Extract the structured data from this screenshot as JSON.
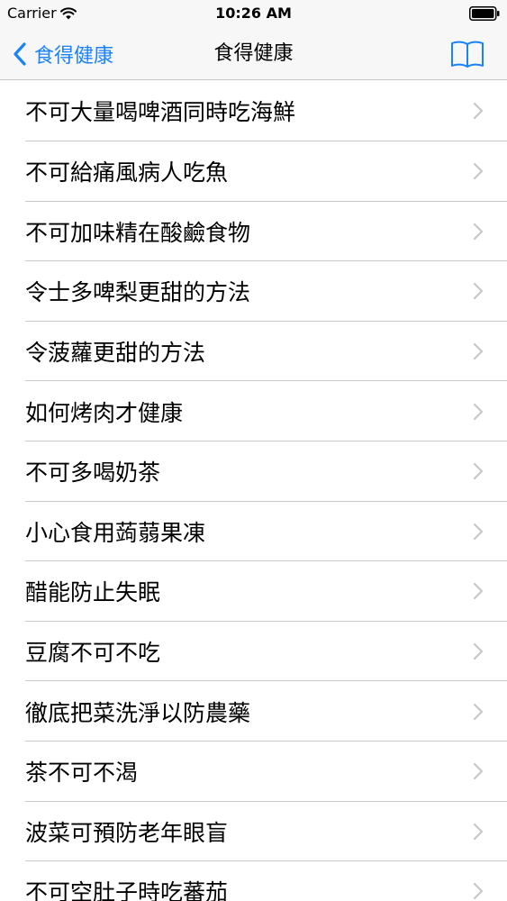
{
  "status_bar": {
    "carrier": "Carrier",
    "time": "10:26 AM",
    "wifi_icon": "wifi-icon",
    "battery_icon": "battery-icon"
  },
  "nav_bar": {
    "back_label": "食得健康",
    "title": "食得健康",
    "back_icon": "chevron-left-icon",
    "right_icon": "book-icon",
    "accent_color": "#1a82fb"
  },
  "list": {
    "items": [
      {
        "label": "不可大量喝啤酒同時吃海鮮"
      },
      {
        "label": "不可給痛風病人吃魚"
      },
      {
        "label": "不可加味精在酸鹼食物"
      },
      {
        "label": "令士多啤梨更甜的方法"
      },
      {
        "label": "令菠蘿更甜的方法"
      },
      {
        "label": "如何烤肉才健康"
      },
      {
        "label": "不可多喝奶茶"
      },
      {
        "label": "小心食用蒟蒻果凍"
      },
      {
        "label": "醋能防止失眠"
      },
      {
        "label": "豆腐不可不吃"
      },
      {
        "label": "徹底把菜洗淨以防農藥"
      },
      {
        "label": "茶不可不渴"
      },
      {
        "label": "波菜可預防老年眼盲"
      },
      {
        "label": "不可空肚子時吃蕃茄"
      }
    ],
    "row_icon": "chevron-right-icon",
    "separator_color": "#c8c7cc"
  }
}
